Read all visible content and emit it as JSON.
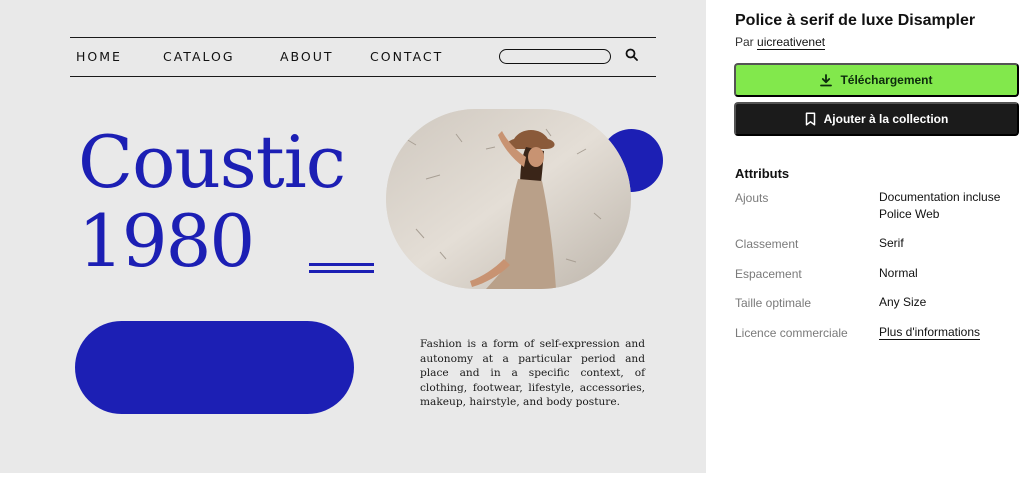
{
  "preview": {
    "nav": [
      "HOME",
      "CATALOG",
      "ABOUT",
      "CONTACT"
    ],
    "title_line1": "Coustic",
    "title_line2": "1980",
    "body_text": "Fashion is a form of self-expression and autonomy at a particular period and place and in a specific context, of clothing, footwear, lifestyle, accessories, makeup, hairstyle, and body posture.",
    "accent_color": "#1c1fb4"
  },
  "info": {
    "title": "Police à serif de luxe Disampler",
    "by_prefix": "Par",
    "author": "uicreativenet",
    "download_label": "Téléchargement",
    "collection_label": "Ajouter à la collection",
    "attributes_heading": "Attributs",
    "attributes": [
      {
        "label": "Ajouts",
        "value": [
          "Documentation incluse",
          "Police Web"
        ]
      },
      {
        "label": "Classement",
        "value": [
          "Serif"
        ]
      },
      {
        "label": "Espacement",
        "value": [
          "Normal"
        ]
      },
      {
        "label": "Taille optimale",
        "value": [
          "Any Size"
        ]
      },
      {
        "label": "Licence commerciale",
        "value": [
          "Plus d'informations"
        ]
      }
    ],
    "download_color": "#82e84c",
    "collection_color": "#1b1b1b"
  }
}
